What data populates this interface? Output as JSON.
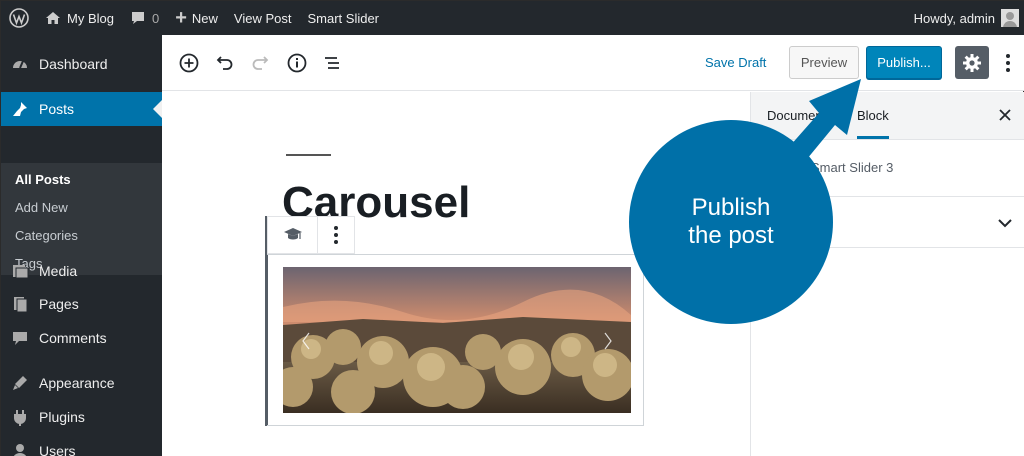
{
  "adminbar": {
    "site_name": "My Blog",
    "comments_count": "0",
    "new_label": "New",
    "view_post_label": "View Post",
    "smart_slider_label": "Smart Slider",
    "howdy": "Howdy, admin"
  },
  "sidebar": {
    "items": [
      {
        "label": "Dashboard",
        "icon": "dashboard-icon"
      },
      {
        "label": "Posts",
        "icon": "pin-icon"
      },
      {
        "label": "Media",
        "icon": "media-icon"
      },
      {
        "label": "Pages",
        "icon": "pages-icon"
      },
      {
        "label": "Comments",
        "icon": "comments-icon"
      },
      {
        "label": "Appearance",
        "icon": "appearance-icon"
      },
      {
        "label": "Plugins",
        "icon": "plugins-icon"
      },
      {
        "label": "Users",
        "icon": "users-icon"
      }
    ],
    "submenu": [
      "All Posts",
      "Add New",
      "Categories",
      "Tags"
    ]
  },
  "header": {
    "save_draft": "Save Draft",
    "preview": "Preview",
    "publish": "Publish..."
  },
  "editor": {
    "title": "Carousel"
  },
  "panel": {
    "tab_document": "Document",
    "tab_block": "Block",
    "block_name": "Smart Slider 3"
  },
  "callout": {
    "line1": "Publish",
    "line2": "the post"
  },
  "colors": {
    "accent": "#0073aa",
    "callout": "#0070a8",
    "adminbar": "#23282d"
  }
}
